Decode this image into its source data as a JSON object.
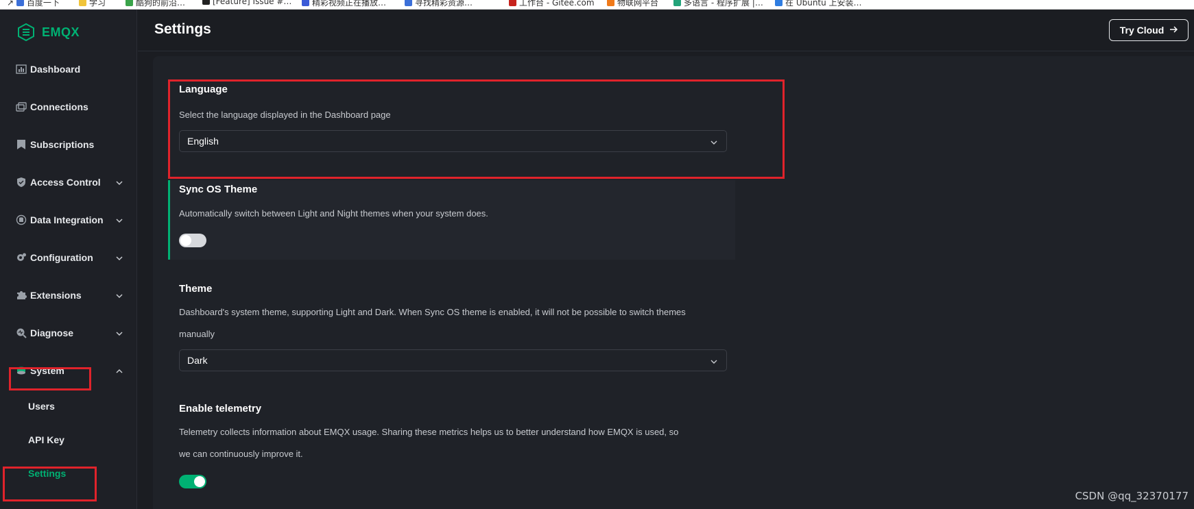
{
  "bookmarks": [
    {
      "label": "百度一下",
      "color": "#3b6fd8"
    },
    {
      "label": "学习",
      "color": "#f0c43a"
    },
    {
      "label": "酷狗的前沿…",
      "color": "#3aa34a"
    },
    {
      "label": "[Feature] Issue #…",
      "color": "#222222"
    },
    {
      "label": "精彩视频正在播放…",
      "color": "#3b5bd8"
    },
    {
      "label": "寻找精彩资源…",
      "color": "#3b6fd8"
    },
    {
      "label": "工作台 - Gitee.com",
      "color": "#c7231d"
    },
    {
      "label": "物联网平台",
      "color": "#f07a1a"
    },
    {
      "label": "多语言 - 程序扩展 |…",
      "color": "#23a37a"
    },
    {
      "label": "在 Ubuntu 上安装…",
      "color": "#2f7de1"
    }
  ],
  "brand": {
    "name": "EMQX",
    "accent": "#00b173"
  },
  "header": {
    "title": "Settings",
    "try_cloud": "Try Cloud"
  },
  "sidebar": {
    "items": [
      {
        "label": "Dashboard",
        "icon": "dashboard-icon"
      },
      {
        "label": "Connections",
        "icon": "connections-icon"
      },
      {
        "label": "Subscriptions",
        "icon": "subscriptions-icon"
      },
      {
        "label": "Access Control",
        "icon": "shield-icon",
        "expandable": true
      },
      {
        "label": "Data Integration",
        "icon": "data-integration-icon",
        "expandable": true
      },
      {
        "label": "Configuration",
        "icon": "gear-icon",
        "expandable": true
      },
      {
        "label": "Extensions",
        "icon": "puzzle-icon",
        "expandable": true
      },
      {
        "label": "Diagnose",
        "icon": "diagnose-icon",
        "expandable": true
      },
      {
        "label": "System",
        "icon": "system-icon",
        "expandable": true,
        "expanded": true
      }
    ],
    "system_children": [
      {
        "label": "Users"
      },
      {
        "label": "API Key"
      },
      {
        "label": "Settings",
        "active": true
      }
    ]
  },
  "settings": {
    "language": {
      "title": "Language",
      "description": "Select the language displayed in the Dashboard page",
      "value": "English"
    },
    "sync_os_theme": {
      "title": "Sync OS Theme",
      "description": "Automatically switch between Light and Night themes when your system does.",
      "enabled": false
    },
    "theme": {
      "title": "Theme",
      "description_line1": "Dashboard's system theme, supporting Light and Dark. When Sync OS theme is enabled, it will not be possible to switch themes",
      "description_line2": "manually",
      "value": "Dark"
    },
    "telemetry": {
      "title": "Enable telemetry",
      "description_line1": "Telemetry collects information about EMQX usage. Sharing these metrics helps us to better understand how EMQX is used, so",
      "description_line2": "we can continuously improve it.",
      "enabled": true
    }
  },
  "watermark": "CSDN @qq_32370177"
}
